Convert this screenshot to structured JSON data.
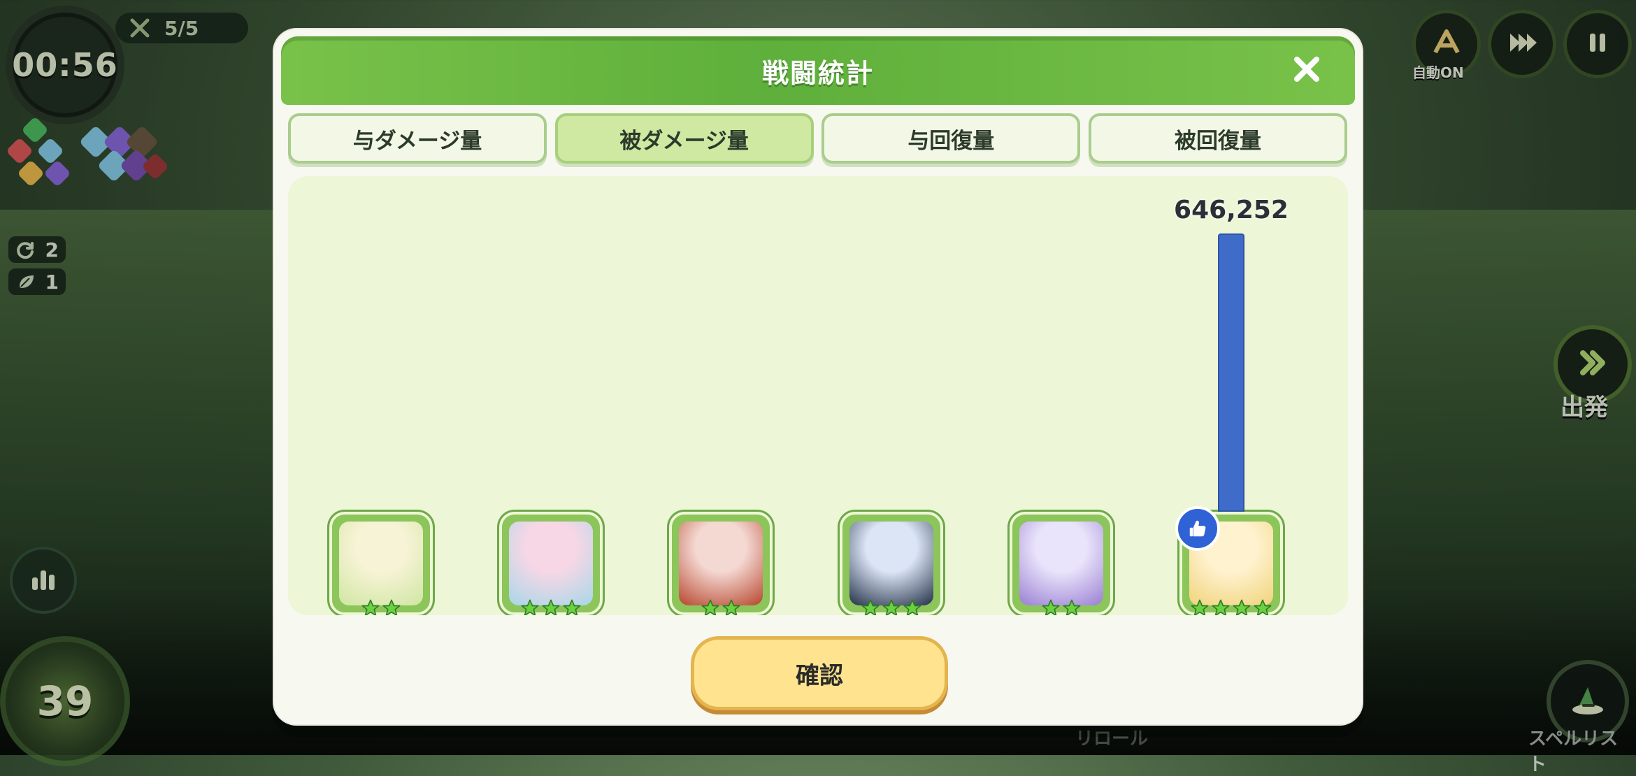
{
  "hud": {
    "timer": "00:56",
    "wave": "5/5",
    "counter_1": "2",
    "counter_2": "1",
    "coins": "39",
    "auto_label": "自動ON",
    "depart_label": "出発",
    "spell_list_label": "スペルリスト",
    "reroll_label": "リロール",
    "icons": {
      "timer_ring": "timer-ring",
      "wave": "crossed-swords-icon",
      "stats": "bar-chart-icon",
      "auto": "auto-icon",
      "fast_forward": "fast-forward-icon",
      "pause": "pause-icon",
      "depart": "double-chevron-icon",
      "spell": "witch-hat-icon"
    }
  },
  "modal": {
    "title": "戦闘統計",
    "tabs": [
      {
        "label": "与ダメージ量",
        "active": false
      },
      {
        "label": "被ダメージ量",
        "active": true
      },
      {
        "label": "与回復量",
        "active": false
      },
      {
        "label": "被回復量",
        "active": false
      }
    ],
    "confirm_label": "確認"
  },
  "chart_data": {
    "type": "bar",
    "categories": [
      "unit_1",
      "unit_2",
      "unit_3",
      "unit_4",
      "unit_5",
      "unit_6"
    ],
    "values": [
      0,
      0,
      0,
      0,
      0,
      646252
    ],
    "value_labels": [
      "",
      "",
      "",
      "",
      "",
      "646,252"
    ],
    "ylim": [
      0,
      646252
    ],
    "grid": false,
    "bar_color": "#3f6cc9"
  },
  "units": [
    {
      "stars": 2,
      "palette": [
        "#f7f3d6",
        "#cfe6a2"
      ],
      "icon_name": "character-portrait"
    },
    {
      "stars": 3,
      "palette": [
        "#f7d7e6",
        "#a7d7e8"
      ],
      "icon_name": "character-portrait"
    },
    {
      "stars": 2,
      "palette": [
        "#f4d8d2",
        "#b7462d"
      ],
      "icon_name": "character-portrait"
    },
    {
      "stars": 3,
      "palette": [
        "#dbe5f6",
        "#233047"
      ],
      "icon_name": "character-portrait"
    },
    {
      "stars": 2,
      "palette": [
        "#e9e4fb",
        "#9a7fd2"
      ],
      "icon_name": "character-portrait"
    },
    {
      "stars": 4,
      "palette": [
        "#fff2cf",
        "#f0d37a"
      ],
      "icon_name": "character-portrait",
      "badge": "thumbs-up-icon"
    }
  ],
  "colors": {
    "accent_green": "#5eaf3b",
    "panel": "#edf6d6",
    "bar": "#3f6cc9",
    "confirm": "#ffe38e"
  }
}
